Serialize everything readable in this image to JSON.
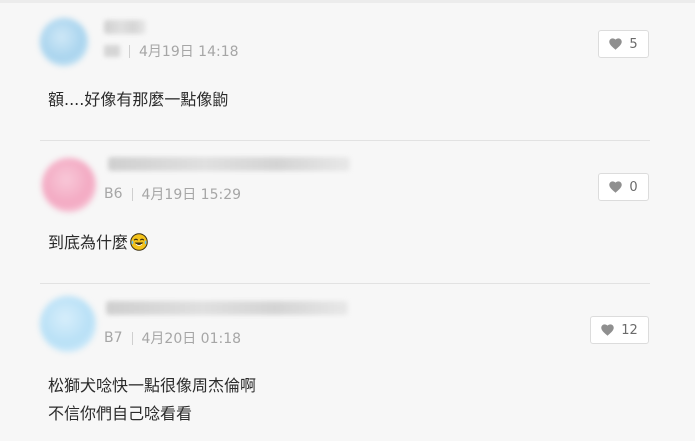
{
  "comments": [
    {
      "floor": "",
      "date": "4月19日 14:18",
      "likes": "5",
      "text": "額....好像有那麼一點像鼩"
    },
    {
      "floor": "B6",
      "date": "4月19日 15:29",
      "likes": "0",
      "text": "到底為什麼",
      "emoji": "laughing-tears-emoji"
    },
    {
      "floor": "B7",
      "date": "4月20日 01:18",
      "likes": "12",
      "text": "松獅犬唸快一點很像周杰倫啊\n不信你們自己唸看看"
    }
  ],
  "icons": {
    "like": "heart-icon"
  },
  "colors": {
    "background": "#f7f7f7",
    "meta_text": "#a6a6a6",
    "heart": "#8f8f8f"
  }
}
